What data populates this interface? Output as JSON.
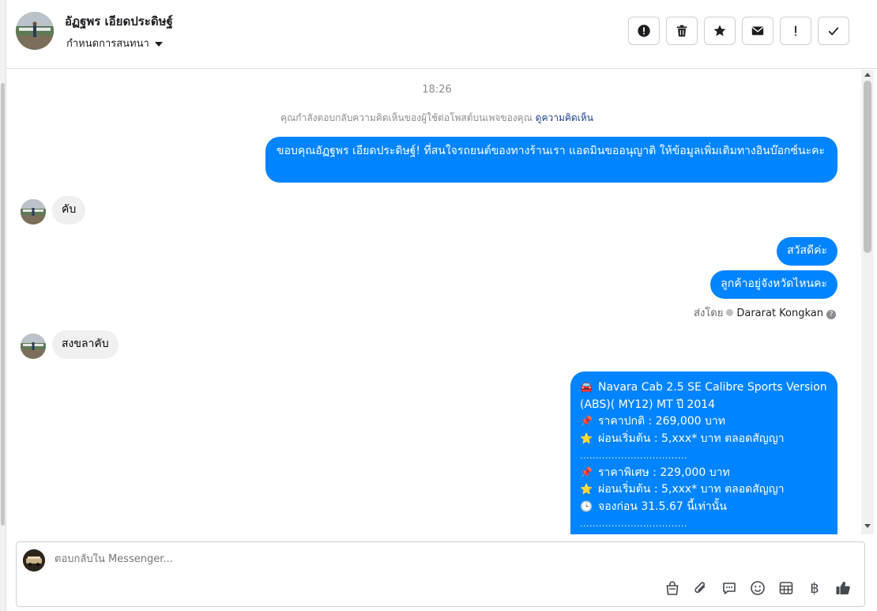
{
  "header": {
    "contact_name": "อัฏฐพร เอียดประดิษฐ์",
    "assign_label": "กำหนดการสนทนา",
    "toolbar_icons": [
      "alert-circle-icon",
      "trash-icon",
      "star-icon",
      "envelope-icon",
      "exclamation-icon",
      "check-icon"
    ]
  },
  "conversation": {
    "timestamp": "18:26",
    "reply_note": "คุณกำลังตอบกลับความคิดเห็นของผู้ใช้ต่อโพสต์บนเพจของคุณ",
    "reply_note_link": "ดูความคิดเห็น",
    "messages": [
      {
        "from": "page",
        "text": "ขอบคุณอัฏฐพร เอียดประดิษฐ์! ที่สนใจรถยนต์ของทางร้านเรา แอดมินขออนุญาติ ให้ข้อมูลเพิ่มเติมทางอินบ๊อกซ์นะคะ"
      },
      {
        "from": "user",
        "text": "คับ"
      },
      {
        "from": "page",
        "text": "สวัสดีค่ะ"
      },
      {
        "from": "page",
        "text": "ลูกค้าอยู่จังหวัดไหนคะ"
      },
      {
        "from": "user",
        "text": "สงขลาคับ"
      }
    ],
    "sent_by_label": "ส่งโดย",
    "sent_by_name": "Dararat Kongkan",
    "car_offer": {
      "title_line1": "Navara Cab 2.5 SE Calibre Sports Version",
      "title_line2": "(ABS)( MY12) MT ปี 2014",
      "normal_price": "ราคาปกติ : 269,000 บาท",
      "installment1": "ผ่อนเริ่มต้น : 5,xxx* บาท ตลอดสัญญา",
      "divider": "..................................",
      "special_price": "ราคาพิเศษ : 229,000 บาท",
      "installment2": "ผ่อนเริ่มต้น : 5,xxx* บาท ตลอดสัญญา",
      "deadline": "จองก่อน 31.5.67 นี้เท่านั้น",
      "divider2": "..................................",
      "emoji_car": "🚘",
      "emoji_pin": "📌",
      "emoji_star": "⭐",
      "emoji_clock": "🕒"
    }
  },
  "composer": {
    "placeholder": "ตอบกลับใน Messenger...",
    "tool_icons": [
      "shopping-bag-icon",
      "paperclip-icon",
      "saved-reply-icon",
      "emoji-icon",
      "table-icon",
      "baht-icon",
      "thumbs-up-icon"
    ],
    "baht_symbol": "฿"
  },
  "colors": {
    "outgoing_bubble": "#0084ff",
    "incoming_bubble": "#f0f0f0",
    "link": "#1c3f8a"
  }
}
